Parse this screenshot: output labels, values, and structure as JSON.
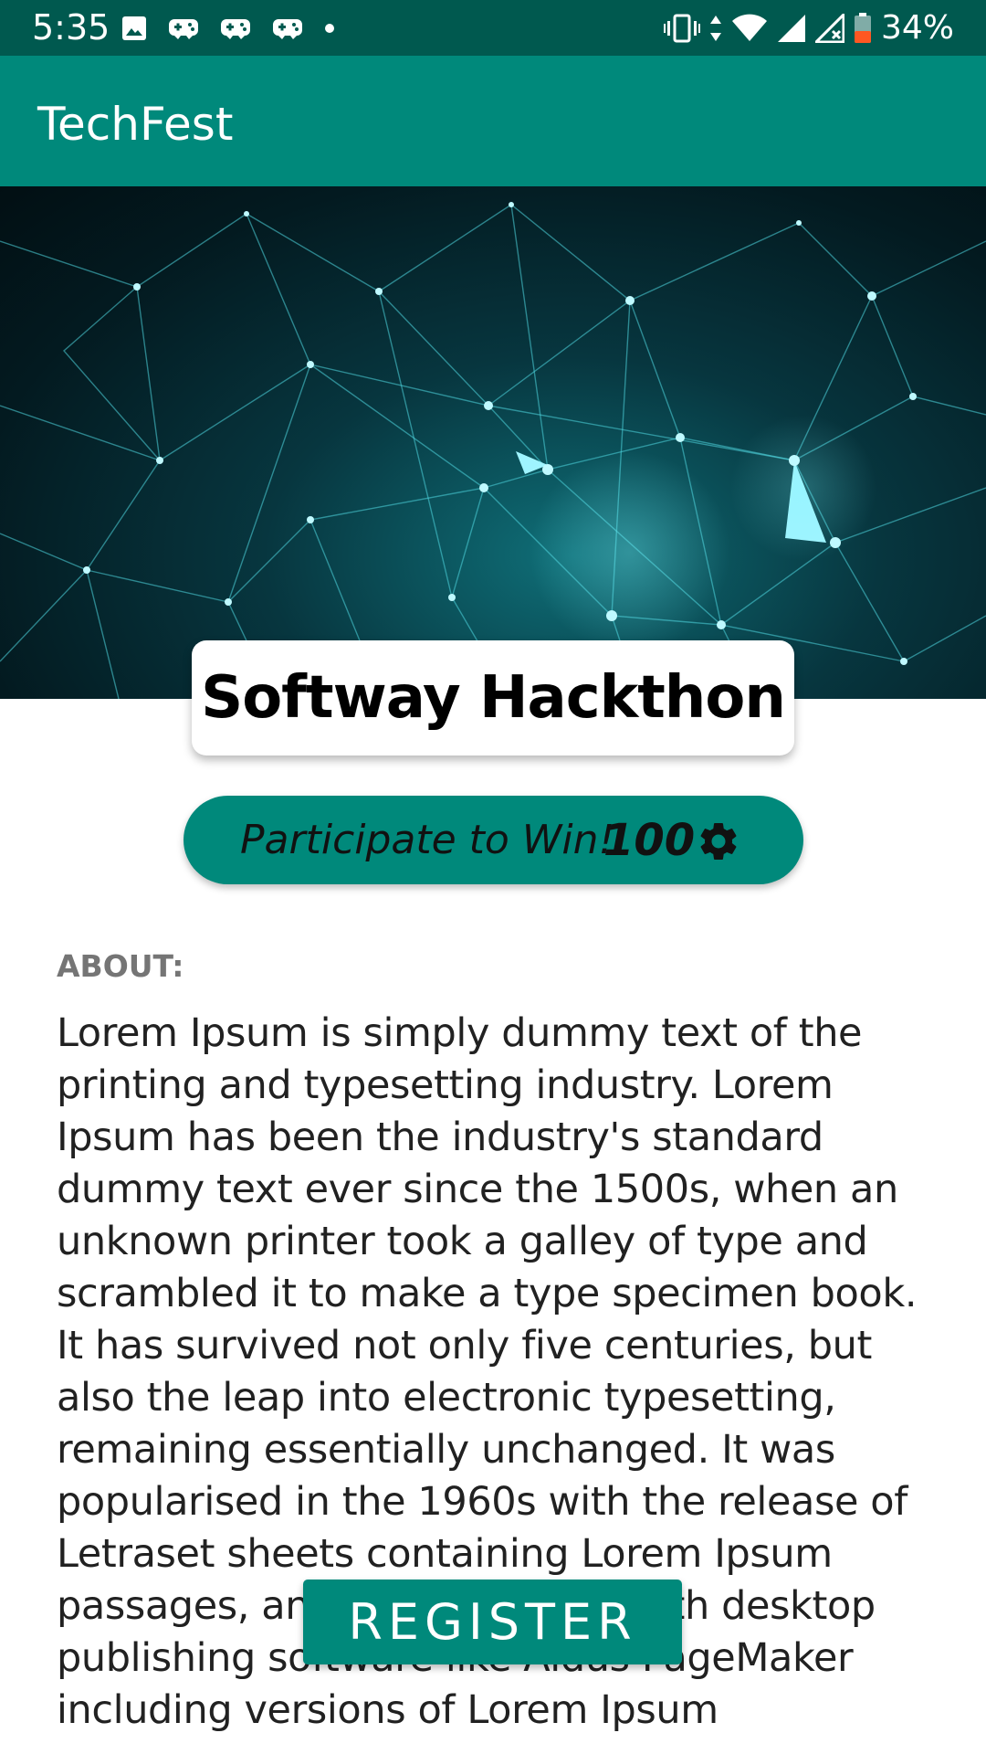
{
  "status_bar": {
    "time": "5:35",
    "battery": "34%",
    "left_icons": [
      "image-icon",
      "game-controller-icon",
      "game-controller-icon",
      "game-controller-icon",
      "dot-icon"
    ],
    "right_icons": [
      "vibrate-icon",
      "data-arrows-icon",
      "wifi-icon",
      "signal-icon",
      "signal-x-icon",
      "battery-icon"
    ]
  },
  "app_bar": {
    "title": "TechFest"
  },
  "hero": {
    "image": "network-banner-image"
  },
  "event": {
    "title": "Softway Hackthon"
  },
  "participate": {
    "label": "Participate to Win!",
    "points": "100",
    "icon": "gear-icon"
  },
  "about": {
    "label": "ABOUT:",
    "text": "Lorem Ipsum is simply dummy text of the printing and typesetting industry. Lorem Ipsum has been the industry's standard dummy text ever since the 1500s, when an unknown printer took a galley of type and scrambled it to make a type specimen book. It has survived not only five centuries, but also the leap into electronic typesetting, remaining essentially unchanged. It was popularised in the 1960s with the release of Letraset sheets containing Lorem Ipsum passages, and more recently with desktop publishing software like Aldus PageMaker including versions of Lorem Ipsum"
  },
  "register": {
    "label": "REGISTER"
  },
  "colors": {
    "status_bar": "#00594f",
    "primary": "#00897b",
    "text": "#212121",
    "muted": "#757575"
  }
}
